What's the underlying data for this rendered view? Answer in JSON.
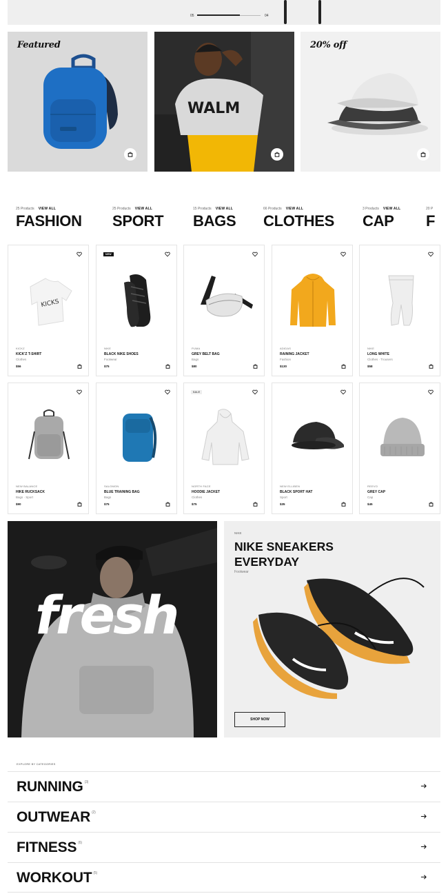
{
  "slider": {
    "current": "05",
    "total": "04"
  },
  "features": [
    {
      "tag": "Featured",
      "bg": "#dadada"
    },
    {
      "tag": "",
      "bg": "#2a2a2a"
    },
    {
      "tag": "20% off",
      "bg": "#f1f1f1"
    }
  ],
  "categories": [
    {
      "count": "25 Products",
      "view": "VIEW ALL",
      "name": "FASHION"
    },
    {
      "count": "25 Products",
      "view": "VIEW ALL",
      "name": "SPORT"
    },
    {
      "count": "15 Products",
      "view": "VIEW ALL",
      "name": "BAGS"
    },
    {
      "count": "66 Products",
      "view": "VIEW ALL",
      "name": "CLOTHES"
    },
    {
      "count": "3 Products",
      "view": "VIEW ALL",
      "name": "CAP"
    },
    {
      "count": "20 P",
      "view": "",
      "name": "F"
    }
  ],
  "products": [
    {
      "brand": "KICKZ",
      "name": "KICK'Z T-SHIRT",
      "category": "Clothes",
      "price": "$56",
      "badge": ""
    },
    {
      "brand": "NIKE",
      "name": "BLACK NIKE SHOES",
      "category": "Footwear",
      "price": "$75",
      "badge": "NEW"
    },
    {
      "brand": "PUMA",
      "name": "GREY BELT BAG",
      "category": "Bags",
      "price": "$80",
      "badge": ""
    },
    {
      "brand": "ADIDAS",
      "name": "RAINING JACKET",
      "category": "Fashion",
      "price": "$130",
      "badge": ""
    },
    {
      "brand": "NIKE",
      "name": "LONG WHITE",
      "category": "Clothes · Trousers",
      "price": "$58",
      "badge": ""
    },
    {
      "brand": "NEW BALANCE",
      "name": "HIKE RUCKSACK",
      "category": "Bags · Sport",
      "price": "$90",
      "badge": ""
    },
    {
      "brand": "SALOMON",
      "name": "BLUE TRAINING BAG",
      "category": "Bags",
      "price": "$75",
      "badge": ""
    },
    {
      "brand": "NORTH FACE",
      "name": "HOODIE JACKET",
      "category": "Clothes",
      "price": "$75",
      "badge": "SALE"
    },
    {
      "brand": "NEW ELLIBEN",
      "name": "BLACK SPORT HAT",
      "category": "Sport",
      "price": "$35",
      "badge": ""
    },
    {
      "brand": "REEVO",
      "name": "GREY CAP",
      "category": "Cap",
      "price": "$45",
      "badge": ""
    }
  ],
  "promo_fresh": {
    "word": "fresh"
  },
  "promo_nike": {
    "brand": "NIKE",
    "title": "NIKE SNEAKERS EVERYDAY",
    "subtitle": "Footwear",
    "button": "SHOP NOW"
  },
  "explore": {
    "title": "EXPLORE BY CATEGORIES",
    "items": [
      {
        "label": "RUNNING",
        "count": "(3)"
      },
      {
        "label": "OUTWEAR",
        "count": "(2)"
      },
      {
        "label": "FITNESS",
        "count": "(6)"
      },
      {
        "label": "WORKOUT",
        "count": "(5)"
      }
    ]
  },
  "colors": {
    "text": "#111111",
    "border": "#e4e4e4",
    "tile": "#efefef",
    "accent_yellow": "#f2b705"
  }
}
